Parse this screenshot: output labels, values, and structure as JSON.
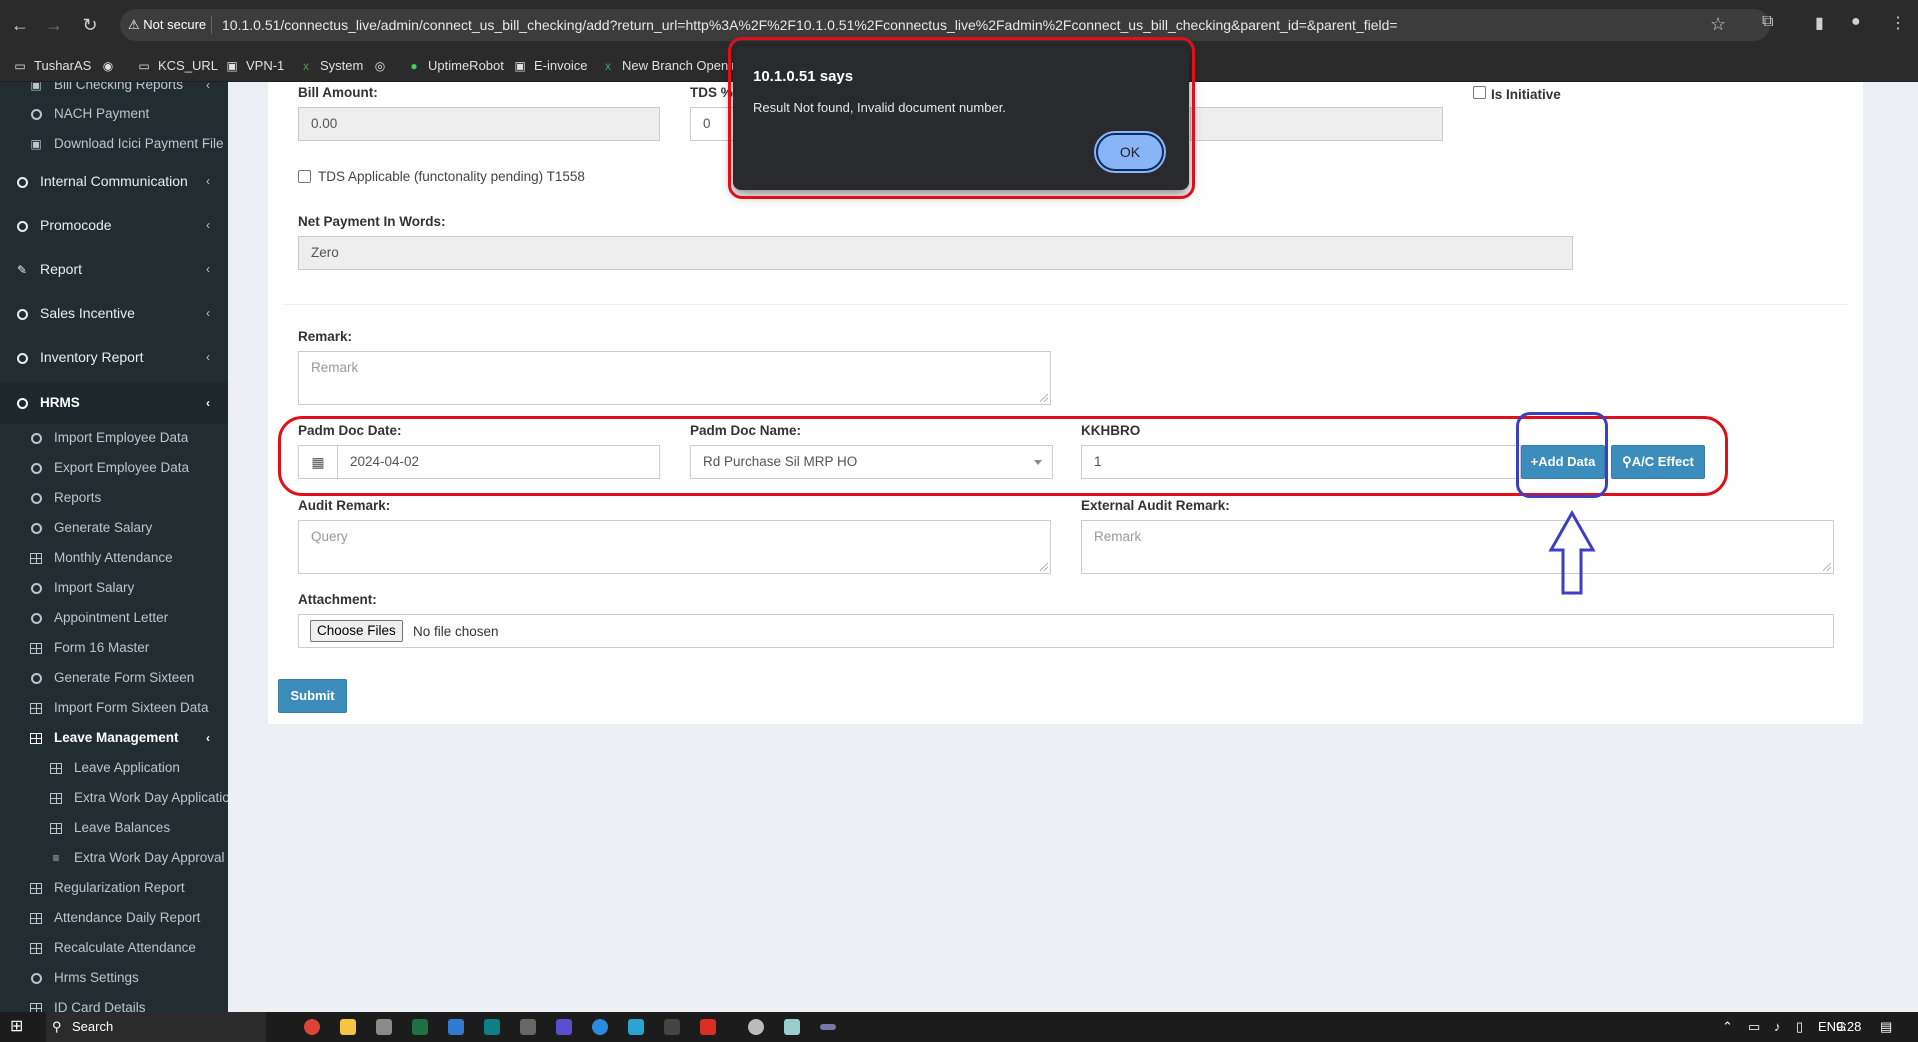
{
  "browser": {
    "security": "Not secure",
    "url": "10.1.0.51/connectus_live/admin/connect_us_bill_checking/add?return_url=http%3A%2F%2F10.1.0.51%2Fconnectus_live%2Fadmin%2Fconnect_us_bill_checking&parent_id=&parent_field=",
    "bookmarks": [
      "TusharAS",
      "KCS_URL",
      "VPN-1",
      "System",
      "UptimeRobot",
      "E-invoice",
      "New Branch Openin"
    ]
  },
  "sidebar": {
    "items": [
      {
        "label": "Bill Checking Reports"
      },
      {
        "label": "NACH Payment"
      },
      {
        "label": "Download Icici Payment File"
      },
      {
        "label": "Internal Communication"
      },
      {
        "label": "Promocode"
      },
      {
        "label": "Report"
      },
      {
        "label": "Sales Incentive"
      },
      {
        "label": "Inventory Report"
      },
      {
        "label": "HRMS"
      },
      {
        "label": "Import Employee Data"
      },
      {
        "label": "Export Employee Data"
      },
      {
        "label": "Reports"
      },
      {
        "label": "Generate Salary"
      },
      {
        "label": "Monthly Attendance"
      },
      {
        "label": "Import Salary"
      },
      {
        "label": "Appointment Letter"
      },
      {
        "label": "Form 16 Master"
      },
      {
        "label": "Generate Form Sixteen"
      },
      {
        "label": "Import Form Sixteen Data"
      },
      {
        "label": "Leave Management"
      },
      {
        "label": "Leave Application"
      },
      {
        "label": "Extra Work Day Application"
      },
      {
        "label": "Leave Balances"
      },
      {
        "label": "Extra Work Day Approval"
      },
      {
        "label": "Regularization Report"
      },
      {
        "label": "Attendance Daily Report"
      },
      {
        "label": "Recalculate Attendance"
      },
      {
        "label": "Hrms Settings"
      },
      {
        "label": "ID Card Details"
      }
    ]
  },
  "form": {
    "bill_amount_label": "Bill Amount:",
    "bill_amount_value": "0.00",
    "tds_label": "TDS %",
    "tds_value": "0",
    "is_initiative_label": "Is Initiative",
    "tds_applicable_label": "TDS Applicable (functonality pending) T1558",
    "net_payment_words_label": "Net Payment In Words:",
    "net_payment_words_value": "Zero",
    "remark_label": "Remark:",
    "remark_placeholder": "Remark",
    "padm_doc_date_label": "Padm Doc Date:",
    "padm_doc_date_value": "2024-04-02",
    "padm_doc_name_label": "Padm Doc Name:",
    "padm_doc_name_value": "Rd Purchase Sil MRP HO",
    "kkhbro_label": "KKHBRO",
    "kkhbro_value": "1",
    "add_data_label": "+Add Data",
    "ac_effect_label": "A/C Effect",
    "audit_remark_label": "Audit Remark:",
    "audit_remark_placeholder": "Query",
    "external_audit_remark_label": "External Audit Remark:",
    "external_audit_remark_placeholder": "Remark",
    "attachment_label": "Attachment:",
    "choose_files_label": "Choose Files",
    "no_file_text": "No file chosen",
    "submit_label": "Submit"
  },
  "dialog": {
    "title": "10.1.0.51 says",
    "message": "Result Not found, Invalid document number.",
    "ok_label": "OK"
  },
  "taskbar": {
    "search_label": "Search",
    "language": "ENG",
    "time": "9:28"
  },
  "colors": {
    "primary": "#3c8dbc",
    "sidebar_bg": "#222d32",
    "annotation_red": "#e0101a",
    "annotation_blue": "#3a3fc4"
  }
}
